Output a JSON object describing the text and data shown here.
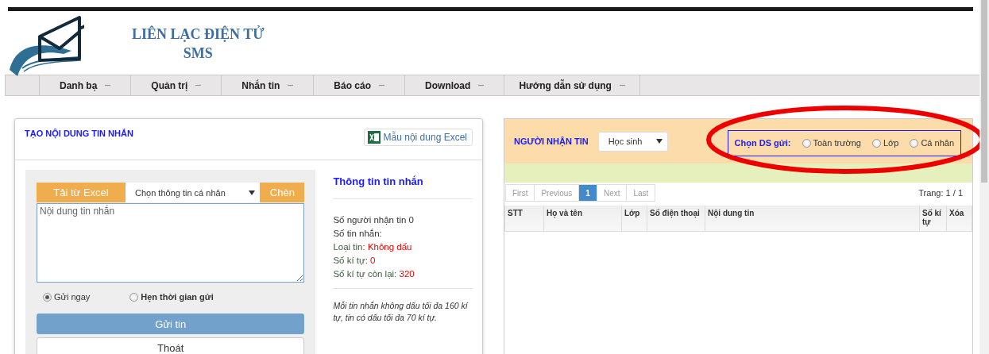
{
  "header": {
    "title_lines": [
      "LIÊN LẠC ĐIỆN TỬ",
      "SMS"
    ]
  },
  "nav": {
    "items": [
      {
        "label": "Danh bạ"
      },
      {
        "label": "Quản trị"
      },
      {
        "label": "Nhắn tin"
      },
      {
        "label": "Báo cáo"
      },
      {
        "label": "Download"
      },
      {
        "label": "Hướng dẫn sử dụng"
      }
    ]
  },
  "compose": {
    "title": "TẠO NỘI DUNG TIN NHẮN",
    "template_button": "Mẫu nội dung Excel",
    "excel_button": "Tải từ Excel",
    "field_select": "Chọn thông tin cá nhân",
    "insert_button": "Chèn",
    "message": {
      "placeholder": "Nội dung tin nhắn"
    },
    "send_options": [
      {
        "label": "Gửi ngay",
        "selected": true,
        "bold": false
      },
      {
        "label": "Hẹn thời gian gửi",
        "selected": false,
        "bold": true
      }
    ],
    "send_button": "Gửi tin",
    "exit_button": "Thoát"
  },
  "info": {
    "title": "Thông tin tin nhắn",
    "lines": [
      {
        "kind": "plain",
        "label": "Số người nhận tin 0"
      },
      {
        "kind": "plain",
        "label": "Số tin nhắn:"
      },
      {
        "kind": "counter",
        "label": "Loại tin:",
        "value": "Không dấu"
      },
      {
        "kind": "counter",
        "label": "Số kí tự:",
        "value": "0"
      },
      {
        "kind": "counter",
        "label": "Số kí tự còn lại:",
        "value": "320"
      }
    ],
    "note": "Mỗi tin nhắn không dấu tối đa 160 kí tự, tin có dấu tối đa 70 kí tự."
  },
  "recipients": {
    "title": "NGƯỜI NHẬN TIN",
    "type_select": "Học sinh",
    "list_label": "Chọn DS gửi:",
    "list_options": [
      {
        "label": "Toàn trường",
        "selected": false
      },
      {
        "label": "Lớp",
        "selected": false
      },
      {
        "label": "Cá nhân",
        "selected": false
      }
    ],
    "pagination": [
      {
        "label": "First",
        "selected": false
      },
      {
        "label": "Previous",
        "selected": false
      },
      {
        "label": "1",
        "selected": true
      },
      {
        "label": "Next",
        "selected": false
      },
      {
        "label": "Last",
        "selected": false
      }
    ],
    "page_info": "Trang: 1 / 1",
    "columns": [
      "STT",
      "Họ và tên",
      "Lớp",
      "Số điện thoại",
      "Nội dung tin",
      "Số kí tự",
      "Xóa"
    ]
  }
}
